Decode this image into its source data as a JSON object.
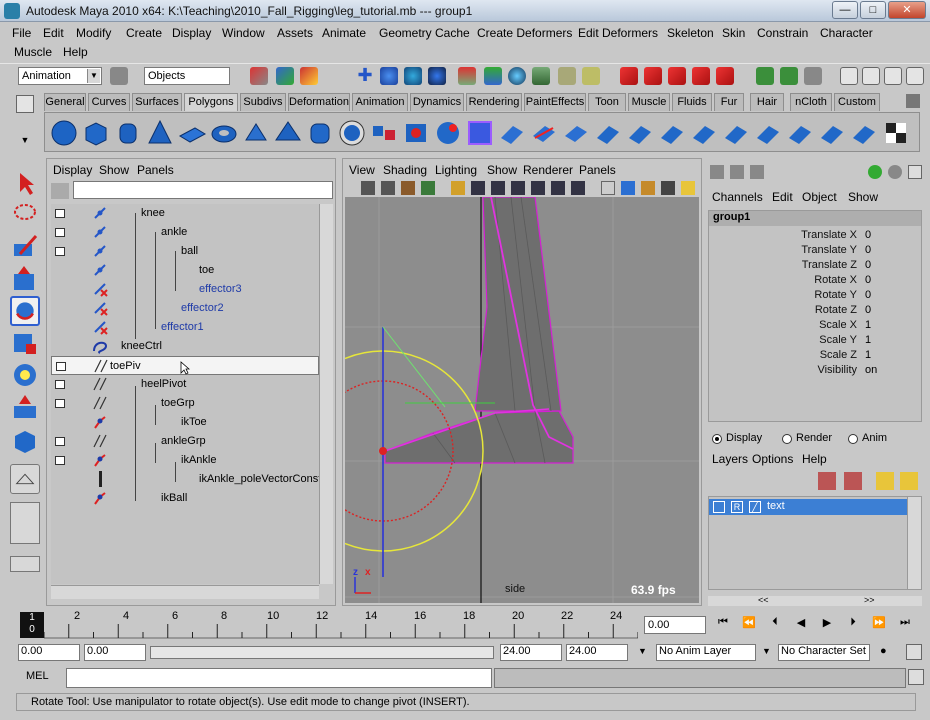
{
  "window": {
    "title": "Autodesk Maya 2010 x64: K:\\Teaching\\2010_Fall_Rigging\\leg_tutorial.mb  ---  group1",
    "min_label": "—",
    "max_label": "□",
    "close_label": "✕"
  },
  "menus": {
    "row1": [
      "File",
      "Edit",
      "Modify",
      "Create",
      "Display",
      "Window",
      "Assets",
      "Animate",
      "Geometry Cache",
      "Create Deformers",
      "Edit Deformers",
      "Skeleton",
      "Skin",
      "Constrain",
      "Character"
    ],
    "row2": [
      "Muscle",
      "Help"
    ]
  },
  "statusline": {
    "menuset": "Animation",
    "selection_mode": "Objects"
  },
  "shelf": {
    "tabs": [
      "General",
      "Curves",
      "Surfaces",
      "Polygons",
      "Subdivs",
      "Deformation",
      "Animation",
      "Dynamics",
      "Rendering",
      "PaintEffects",
      "Toon",
      "Muscle",
      "Fluids",
      "Fur",
      "Hair",
      "nCloth",
      "Custom"
    ],
    "active_tab": "Polygons"
  },
  "outliner": {
    "menus": [
      "Display",
      "Show",
      "Panels"
    ],
    "items": [
      {
        "label": "knee",
        "icon": "joint-icon"
      },
      {
        "label": "ankle",
        "icon": "joint-icon"
      },
      {
        "label": "ball",
        "icon": "joint-icon"
      },
      {
        "label": "toe",
        "icon": "joint-icon"
      },
      {
        "label": "effector3",
        "icon": "effector-icon"
      },
      {
        "label": "effector2",
        "icon": "effector-icon"
      },
      {
        "label": "effector1",
        "icon": "effector-icon"
      },
      {
        "label": "kneeCtrl",
        "icon": "curve-icon"
      },
      {
        "label": "toePiv",
        "icon": "group-icon"
      },
      {
        "label": "heelPivot",
        "icon": "group-icon"
      },
      {
        "label": "toeGrp",
        "icon": "group-icon"
      },
      {
        "label": "ikToe",
        "icon": "ik-handle-icon"
      },
      {
        "label": "ankleGrp",
        "icon": "group-icon"
      },
      {
        "label": "ikAnkle",
        "icon": "ik-handle-icon"
      },
      {
        "label": "ikAnkle_poleVectorConstr",
        "icon": "constraint-icon"
      },
      {
        "label": "ikBall",
        "icon": "ik-handle-icon"
      }
    ]
  },
  "viewport": {
    "menus": [
      "View",
      "Shading",
      "Lighting",
      "Show",
      "Renderer",
      "Panels"
    ],
    "camera_label": "side",
    "fps": "63.9 fps",
    "axis_z": "z",
    "axis_x": "x"
  },
  "channelbox": {
    "menus": [
      "Channels",
      "Edit",
      "Object",
      "Show"
    ],
    "node": "group1",
    "channels": [
      {
        "name": "Translate X",
        "value": "0"
      },
      {
        "name": "Translate Y",
        "value": "0"
      },
      {
        "name": "Translate Z",
        "value": "0"
      },
      {
        "name": "Rotate X",
        "value": "0"
      },
      {
        "name": "Rotate Y",
        "value": "0"
      },
      {
        "name": "Rotate Z",
        "value": "0"
      },
      {
        "name": "Scale X",
        "value": "1"
      },
      {
        "name": "Scale Y",
        "value": "1"
      },
      {
        "name": "Scale Z",
        "value": "1"
      },
      {
        "name": "Visibility",
        "value": "on"
      }
    ]
  },
  "layers": {
    "modes": [
      "Display",
      "Render",
      "Anim"
    ],
    "menus": [
      "Layers",
      "Options",
      "Help"
    ],
    "items": [
      {
        "vis": "V",
        "type": "R",
        "name": "text"
      }
    ],
    "scroll_left": "<<",
    "scroll_right": ">>"
  },
  "timeslider": {
    "ticks": [
      "2",
      "4",
      "6",
      "8",
      "10",
      "12",
      "14",
      "16",
      "18",
      "20",
      "22",
      "24"
    ],
    "current_frame_top": "1",
    "current_frame_bottom": "0",
    "current_time": "0.00"
  },
  "rangeslider": {
    "start": "0.00",
    "anim_start": "0.00",
    "range_end": "24.00",
    "anim_end": "24.00",
    "anim_layer": "No Anim Layer",
    "character_set": "No Character Set"
  },
  "commandline": {
    "label": "MEL"
  },
  "helpline": {
    "text": "Rotate Tool: Use manipulator to rotate object(s). Use edit mode to change pivot (INSERT)."
  }
}
